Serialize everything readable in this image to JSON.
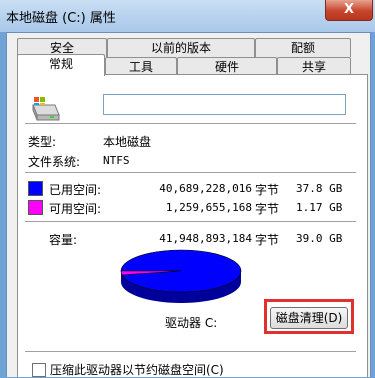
{
  "window": {
    "title": "本地磁盘 (C:) 属性",
    "close_label": "X"
  },
  "tabs_back": [
    "安全",
    "以前的版本",
    "配额"
  ],
  "tabs_front": [
    "常规",
    "工具",
    "硬件",
    "共享"
  ],
  "general": {
    "name_value": "",
    "type_label": "类型:",
    "type_value": "本地磁盘",
    "fs_label": "文件系统:",
    "fs_value": "NTFS",
    "used": {
      "label": "已用空间:",
      "bytes": "40,689,228,016",
      "unit": "字节",
      "size": "37.8 GB",
      "color": "#0000ff"
    },
    "free": {
      "label": "可用空间:",
      "bytes": "1,259,655,168",
      "unit": "字节",
      "size": "1.17 GB",
      "color": "#ff00ff"
    },
    "capacity": {
      "label": "容量:",
      "bytes": "41,948,893,184",
      "unit": "字节",
      "size": "39.0 GB"
    },
    "drive_label": "驱动器 C:",
    "cleanup_button": "磁盘清理(D)",
    "compress_checkbox": "压缩此驱动器以节约磁盘空间(C)"
  },
  "chart_data": {
    "type": "pie",
    "categories": [
      "已用空间",
      "可用空间"
    ],
    "values": [
      40689228016,
      1259655168
    ]
  }
}
